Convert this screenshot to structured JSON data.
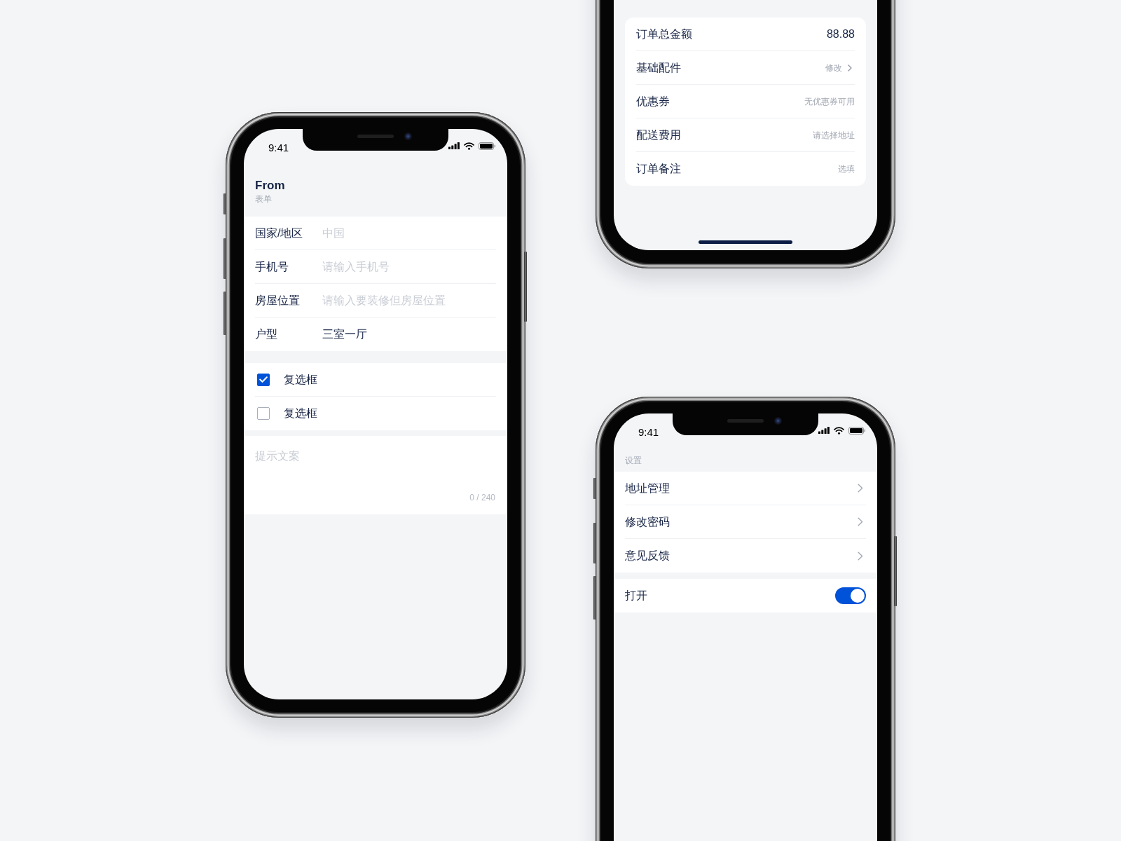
{
  "form_screen": {
    "status_bar": {
      "time": "9:41"
    },
    "header": {
      "title": "From",
      "subtitle": "表单"
    },
    "fields": [
      {
        "label": "国家/地区",
        "placeholder": "中国"
      },
      {
        "label": "手机号",
        "placeholder": "请输入手机号"
      },
      {
        "label": "房屋位置",
        "placeholder": "请输入要装修但房屋位置"
      },
      {
        "label": "户型",
        "value": "三室一厅"
      }
    ],
    "checkboxes": [
      {
        "label": "复选框",
        "checked": true
      },
      {
        "label": "复选框",
        "checked": false
      }
    ],
    "textarea": {
      "placeholder": "提示文案",
      "counter": "0 / 240"
    }
  },
  "order_screen": {
    "rows": [
      {
        "kind": "amount",
        "label": "订单总金额",
        "value": "88.88"
      },
      {
        "kind": "link",
        "label": "基础配件",
        "value": "修改"
      },
      {
        "kind": "hint",
        "label": "优惠券",
        "value": "无优惠券可用"
      },
      {
        "kind": "hint",
        "label": "配送费用",
        "value": "请选择地址"
      },
      {
        "kind": "hint",
        "label": "订单备注",
        "value": "选填"
      }
    ]
  },
  "settings_screen": {
    "status_bar": {
      "time": "9:41"
    },
    "section_title": "设置",
    "items": [
      {
        "label": "地址管理"
      },
      {
        "label": "修改密码"
      },
      {
        "label": "意见反馈"
      }
    ],
    "toggle": {
      "label": "打开",
      "on": true
    }
  }
}
